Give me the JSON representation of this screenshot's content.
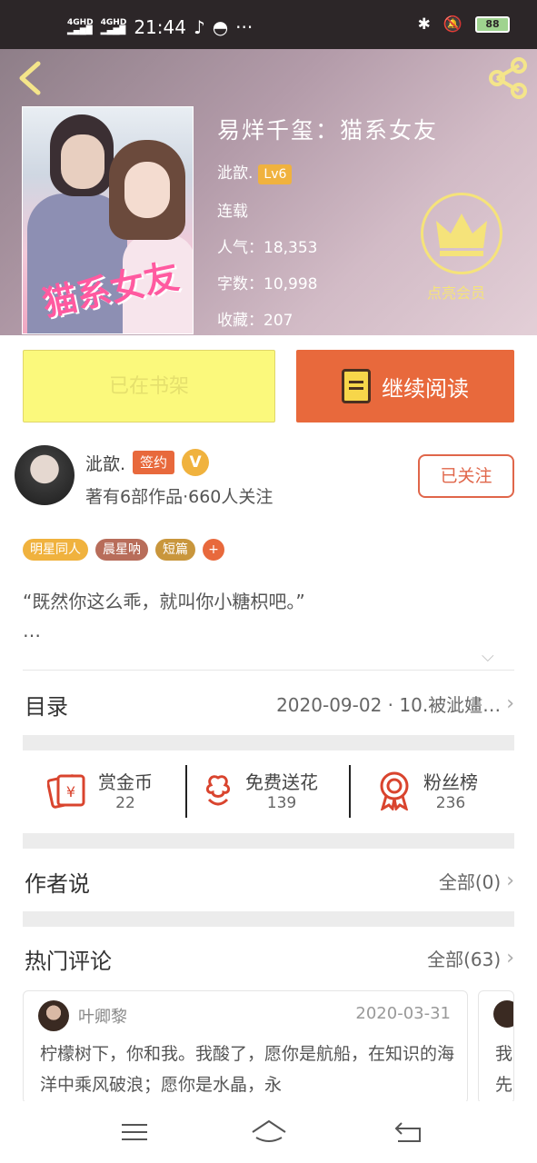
{
  "status_bar": {
    "signal1": "4GHD",
    "signal2": "4GHD",
    "time": "21:44",
    "more": "···",
    "battery": "88"
  },
  "book": {
    "title": "易烊千玺：猫系女友",
    "author": "泚歆.",
    "level": "Lv6",
    "status": "连载",
    "popularity_label": "人气：",
    "popularity": "18,353",
    "words_label": "字数：",
    "words": "10,998",
    "favorites_label": "收藏：",
    "favorites": "207",
    "vip_label": "点亮会员"
  },
  "actions": {
    "shelf": "已在书架",
    "read": "继续阅读"
  },
  "author": {
    "name": "泚歆.",
    "signed": "签约",
    "v": "V",
    "sub": "著有6部作品·660人关注",
    "follow": "已关注"
  },
  "tags": [
    {
      "label": "明星同人",
      "color": "#f0b23e"
    },
    {
      "label": "晨星呐",
      "color": "#b86d5a"
    },
    {
      "label": "短篇",
      "color": "#c9963c"
    },
    {
      "label": "+",
      "color": "#e8693c"
    }
  ],
  "intro": {
    "line1": "“既然你这么乖，就叫你小糖枳吧。”",
    "line2": "…"
  },
  "catalog": {
    "label": "目录",
    "latest": "2020-09-02 · 10.被泚嫿…"
  },
  "stats": [
    {
      "label": "赏金币",
      "value": "22"
    },
    {
      "label": "免费送花",
      "value": "139"
    },
    {
      "label": "粉丝榜",
      "value": "236"
    }
  ],
  "author_says": {
    "label": "作者说",
    "all": "全部(0)"
  },
  "hot_comments": {
    "label": "热门评论",
    "all": "全部(63)",
    "items": [
      {
        "name": "叶卿黎",
        "date": "2020-03-31",
        "text": "柠檬树下，你和我。我酸了，愿你是航船，在知识的海洋中乘风破浪；愿你是水晶，永"
      }
    ],
    "next_preview": "我先"
  },
  "colors": {
    "accent": "#e8693c",
    "gold": "#f0b23e",
    "shelf_bg": "#fbf97c"
  }
}
